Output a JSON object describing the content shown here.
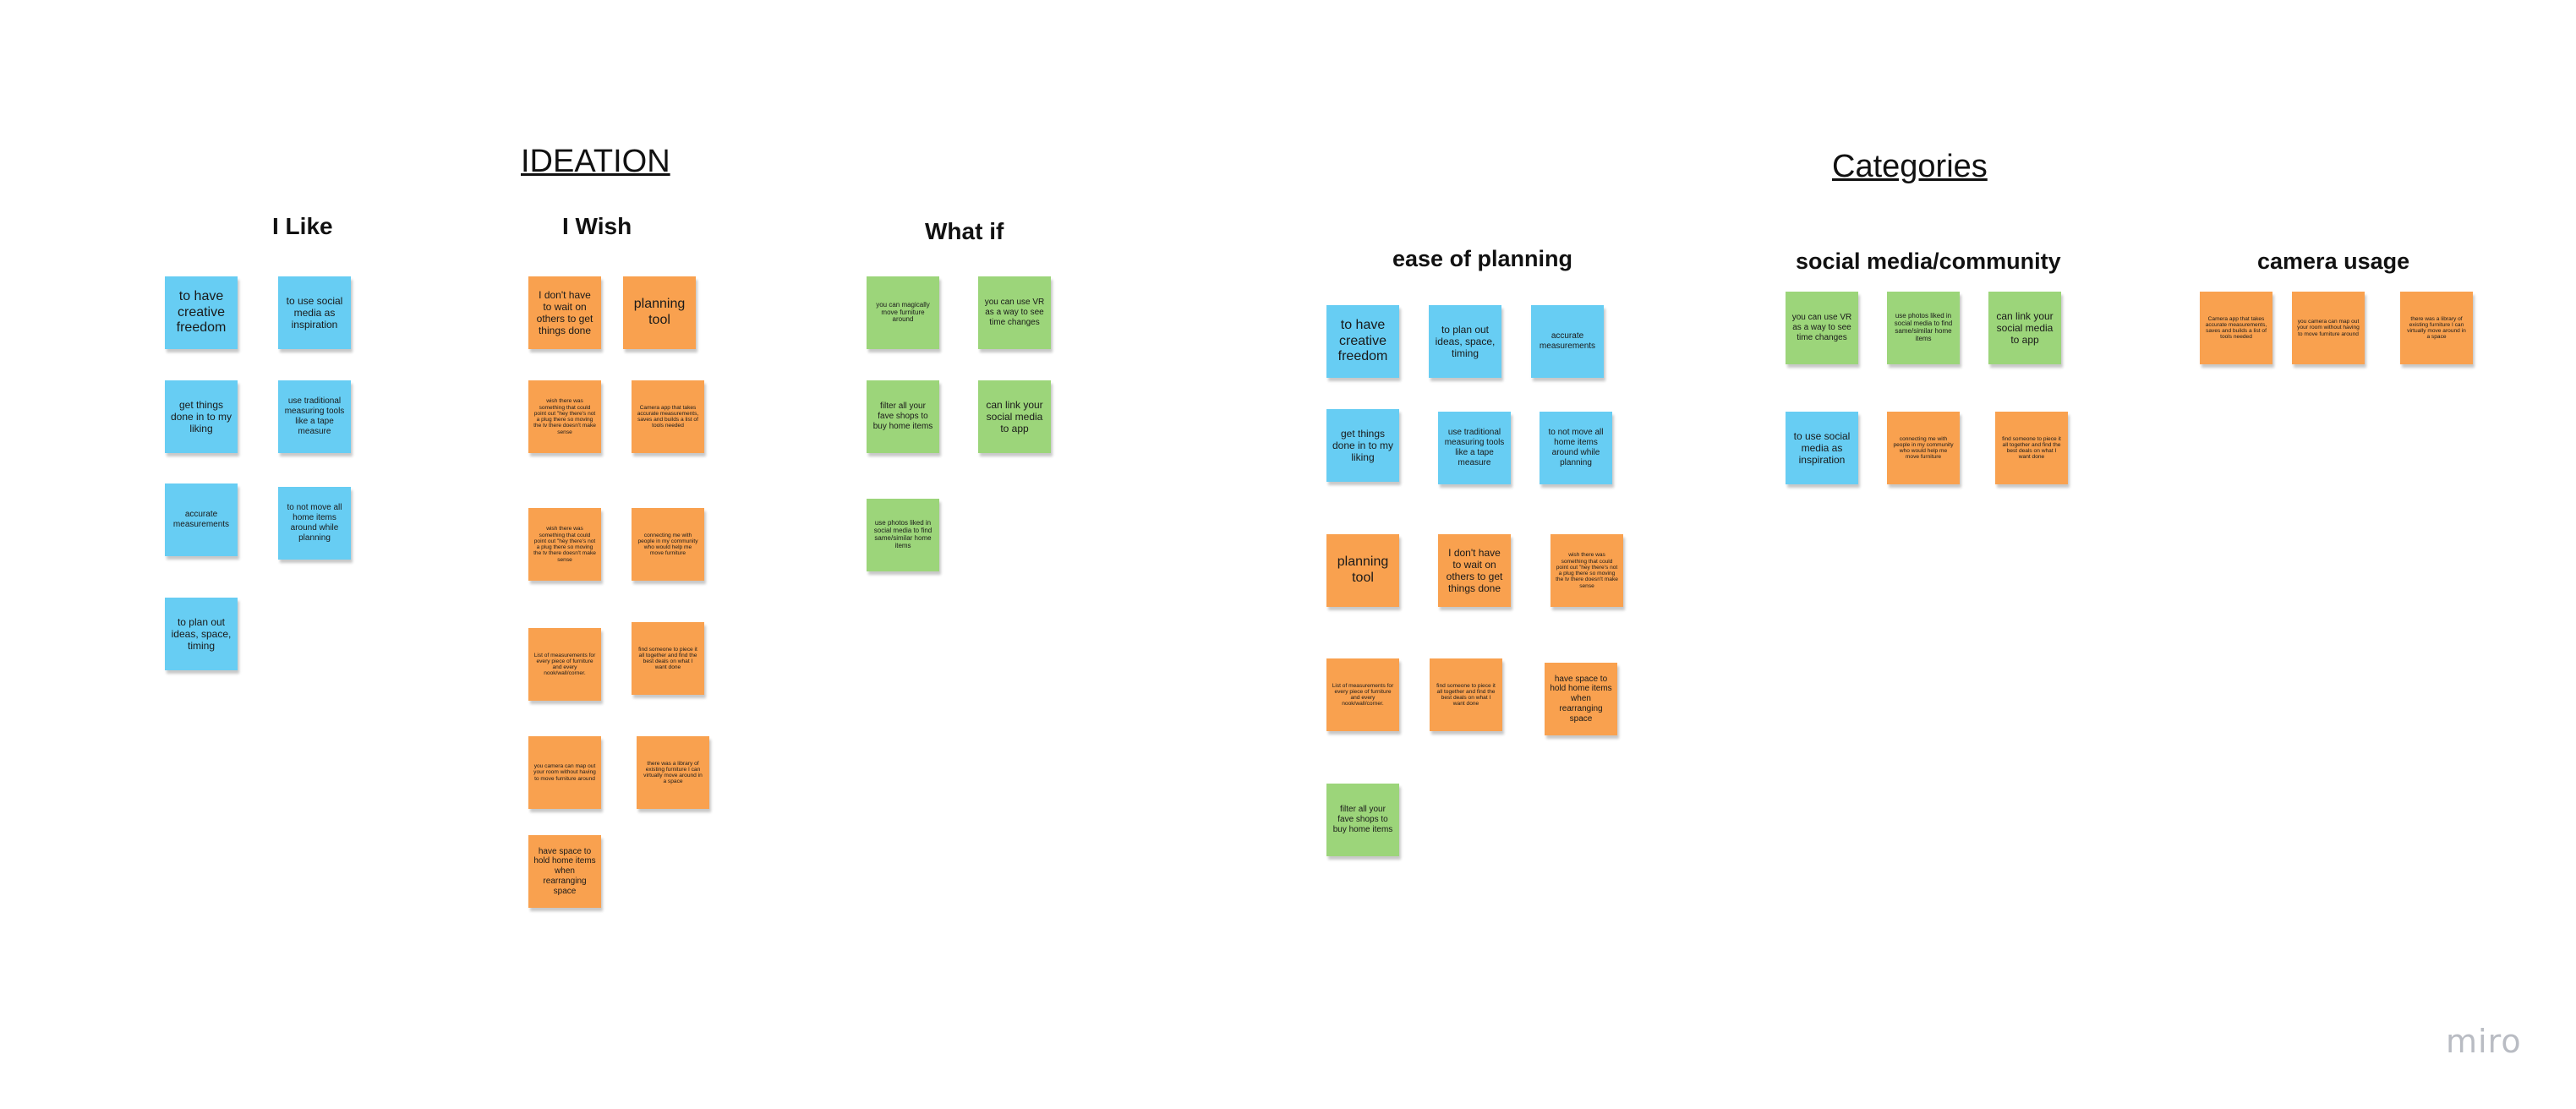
{
  "titles": {
    "ideation": "IDEATION",
    "categories": "Categories"
  },
  "columns": {
    "i_like": "I Like",
    "i_wish": "I Wish",
    "what_if": "What if",
    "ease_of_planning": "ease of planning",
    "social_media_community": "social media/community",
    "camera_usage": "camera usage"
  },
  "brand": {
    "logo": "miro"
  },
  "colors": {
    "blue": "#67cdf3",
    "orange": "#f9a14f",
    "green": "#9cd57a"
  },
  "ideation": {
    "i_like": [
      {
        "text": "to have creative freedom",
        "color": "blue"
      },
      {
        "text": "to use social media as inspiration",
        "color": "blue"
      },
      {
        "text": "get things done in to my liking",
        "color": "blue"
      },
      {
        "text": "use traditional measuring tools like a tape measure",
        "color": "blue"
      },
      {
        "text": "accurate measurements",
        "color": "blue"
      },
      {
        "text": "to not move all home items around while planning",
        "color": "blue"
      },
      {
        "text": "to plan out ideas, space, timing",
        "color": "blue"
      }
    ],
    "i_wish": [
      {
        "text": "I don't have to wait on others to get things done",
        "color": "orange"
      },
      {
        "text": "planning tool",
        "color": "orange"
      },
      {
        "text": "wish there was something that could point out \"hey there's not a plug there so moving the tv there doesn't make sense",
        "color": "orange"
      },
      {
        "text": "Camera app that takes accurate measurements, saves and builds a list of tools needed",
        "color": "orange"
      },
      {
        "text": "wish there was something that could point out \"hey there's not a plug there so moving the tv there doesn't make sense",
        "color": "orange"
      },
      {
        "text": "connecting me with people in my community who would help me move furniture",
        "color": "orange"
      },
      {
        "text": "List of measurements for every piece of furniture and every nook/wall/corner.",
        "color": "orange"
      },
      {
        "text": "find someone to piece it all together and find the best deals on what I want done",
        "color": "orange"
      },
      {
        "text": "you camera can map out your room without having to move furniture around",
        "color": "orange"
      },
      {
        "text": "there was a library of existing furniture I can virtually move around in a space",
        "color": "orange"
      },
      {
        "text": "have space to hold home items when rearranging space",
        "color": "orange"
      }
    ],
    "what_if": [
      {
        "text": "you can magically move furniture around",
        "color": "green"
      },
      {
        "text": "you can use VR as a way to see time changes",
        "color": "green"
      },
      {
        "text": "filter all your fave shops to buy home items",
        "color": "green"
      },
      {
        "text": "can link your social media to app",
        "color": "green"
      },
      {
        "text": "use photos liked in social media to find same/similar home items",
        "color": "green"
      }
    ]
  },
  "categories": {
    "ease_of_planning": [
      {
        "text": "to have creative freedom",
        "color": "blue"
      },
      {
        "text": "to plan out ideas, space, timing",
        "color": "blue"
      },
      {
        "text": "accurate measurements",
        "color": "blue"
      },
      {
        "text": "get things done in to my liking",
        "color": "blue"
      },
      {
        "text": "use traditional measuring tools like a tape measure",
        "color": "blue"
      },
      {
        "text": "to not move all home items around while planning",
        "color": "blue"
      },
      {
        "text": "planning tool",
        "color": "orange"
      },
      {
        "text": "I don't have to wait on others to get things done",
        "color": "orange"
      },
      {
        "text": "wish there was something that could point out \"hey there's not a plug there so moving the tv there doesn't make sense",
        "color": "orange"
      },
      {
        "text": "List of measurements for every piece of furniture and every nook/wall/corner.",
        "color": "orange"
      },
      {
        "text": "find someone to piece it all together and find the best deals on what I want done",
        "color": "orange"
      },
      {
        "text": "have space to hold home items when rearranging space",
        "color": "orange"
      },
      {
        "text": "filter all your fave shops to buy home items",
        "color": "green"
      }
    ],
    "social_media_community": [
      {
        "text": "you can use VR as a way to see time changes",
        "color": "green"
      },
      {
        "text": "use photos liked in social media to find same/similar home items",
        "color": "green"
      },
      {
        "text": "can link your social media to app",
        "color": "green"
      },
      {
        "text": "to use social media as inspiration",
        "color": "blue"
      },
      {
        "text": "connecting me with people in my community who would help me move furniture",
        "color": "orange"
      },
      {
        "text": "find someone to piece it all together and find the best deals on what I want done",
        "color": "orange"
      }
    ],
    "camera_usage": [
      {
        "text": "Camera app that takes accurate measurements, saves and builds a list of tools needed",
        "color": "orange"
      },
      {
        "text": "you camera can map out your room without having to move furniture around",
        "color": "orange"
      },
      {
        "text": "there was a library of existing furniture I can virtually move around in a space",
        "color": "orange"
      }
    ]
  }
}
